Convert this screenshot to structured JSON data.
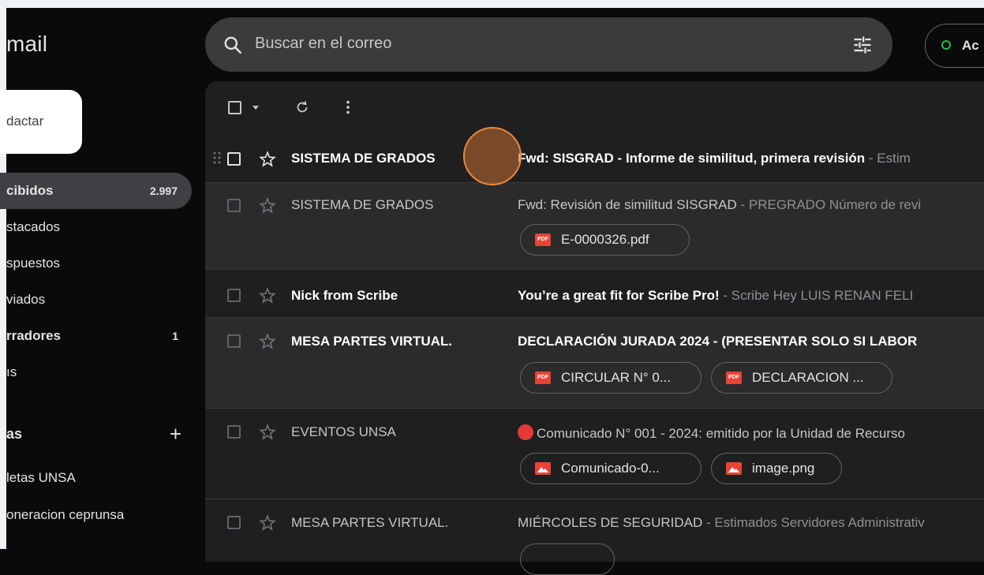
{
  "app": {
    "logo_text": "mail"
  },
  "compose": {
    "label": "dactar"
  },
  "nav": [
    {
      "label": "cibidos",
      "count": "2.997"
    },
    {
      "label": "stacados",
      "count": ""
    },
    {
      "label": "spuestos",
      "count": ""
    },
    {
      "label": "viados",
      "count": ""
    },
    {
      "label": "rradores",
      "count": "1"
    },
    {
      "label": "ıs",
      "count": ""
    }
  ],
  "labels": {
    "heading": "as",
    "add": "+",
    "items": [
      "letas UNSA",
      "oneracion ceprunsa"
    ]
  },
  "search": {
    "placeholder": "Buscar en el correo"
  },
  "status": {
    "label": "Ac",
    "color": "#1fbf4d"
  },
  "mails": [
    {
      "sender": "SISTEMA DE GRADOS",
      "subject": "Fwd: SISGRAD - Informe de similitud, primera revisión",
      "snippet": " - Estim",
      "unread": true
    },
    {
      "sender": "SISTEMA DE GRADOS",
      "subject": "Fwd: Revisión de similitud SISGRAD",
      "snippet": " - PREGRADO Número de revi",
      "unread": false,
      "attachments": [
        {
          "type": "pdf",
          "name": "E-0000326.pdf"
        }
      ]
    },
    {
      "sender": "Nick from Scribe",
      "subject": "You’re a great fit for Scribe Pro!",
      "snippet": " - Scribe Hey LUIS RENAN FELI",
      "unread": true
    },
    {
      "sender": "MESA PARTES VIRTUAL.",
      "subject": "DECLARACIÓN JURADA 2024 - (PRESENTAR SOLO SI LABOR",
      "snippet": "",
      "unread": true,
      "attachments": [
        {
          "type": "pdf",
          "name": "CIRCULAR N° 0..."
        },
        {
          "type": "pdf",
          "name": "DECLARACION ..."
        }
      ]
    },
    {
      "sender": "EVENTOS UNSA",
      "subject": "Comunicado N° 001 - 2024: emitido por la Unidad de Recurso",
      "snippet": "",
      "unread": false,
      "attachments": [
        {
          "type": "image",
          "name": "Comunicado-0..."
        },
        {
          "type": "image",
          "name": "image.png"
        }
      ]
    },
    {
      "sender": "MESA PARTES VIRTUAL.",
      "subject": "MIÉRCOLES DE SEGURIDAD",
      "snippet": " - Estimados Servidores Administrativ",
      "unread": false
    }
  ],
  "file_badges": {
    "pdf": "PDF"
  }
}
